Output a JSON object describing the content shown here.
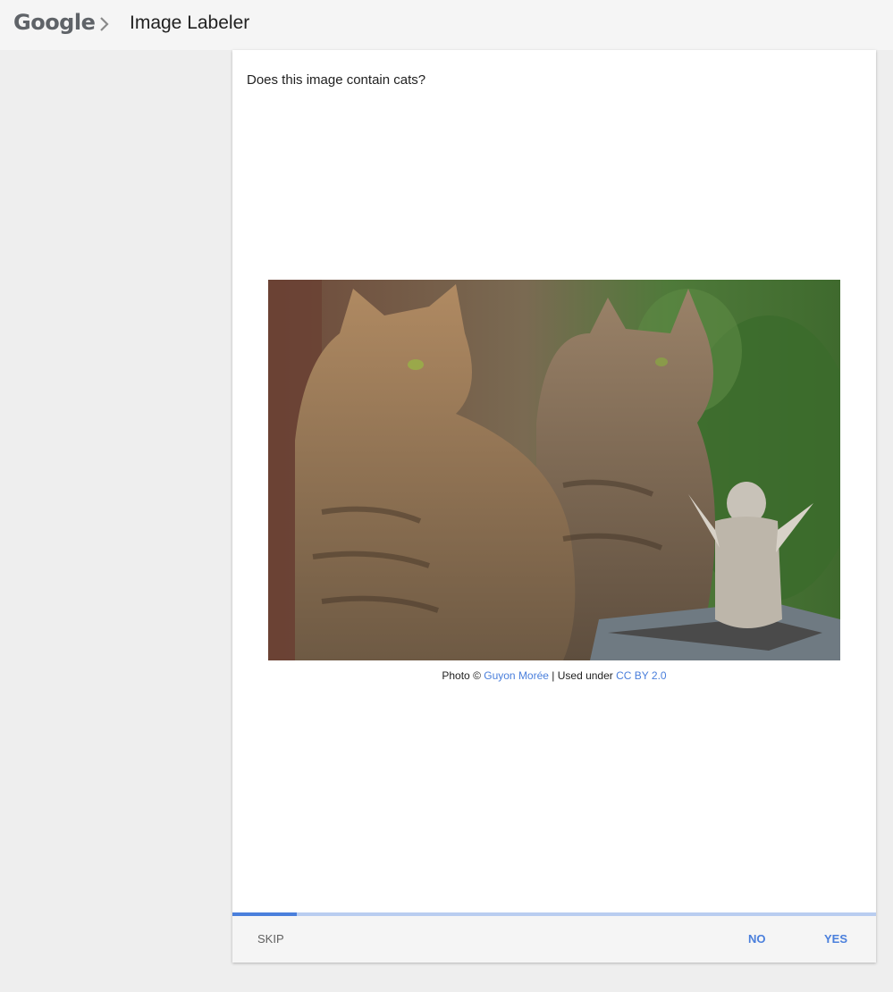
{
  "header": {
    "logo_text": "Google",
    "app_title": "Image Labeler"
  },
  "task": {
    "question": "Does this image contain cats?"
  },
  "credit": {
    "prefix": "Photo © ",
    "author": "Guyon Morée",
    "middle": " | Used under ",
    "license": "CC BY 2.0"
  },
  "progress": {
    "fraction": 0.1
  },
  "actions": {
    "skip_label": "SKIP",
    "no_label": "NO",
    "yes_label": "YES"
  },
  "colors": {
    "accent": "#4a7fdc",
    "progress_track": "#b9cdf0",
    "background": "#eeeeee"
  }
}
